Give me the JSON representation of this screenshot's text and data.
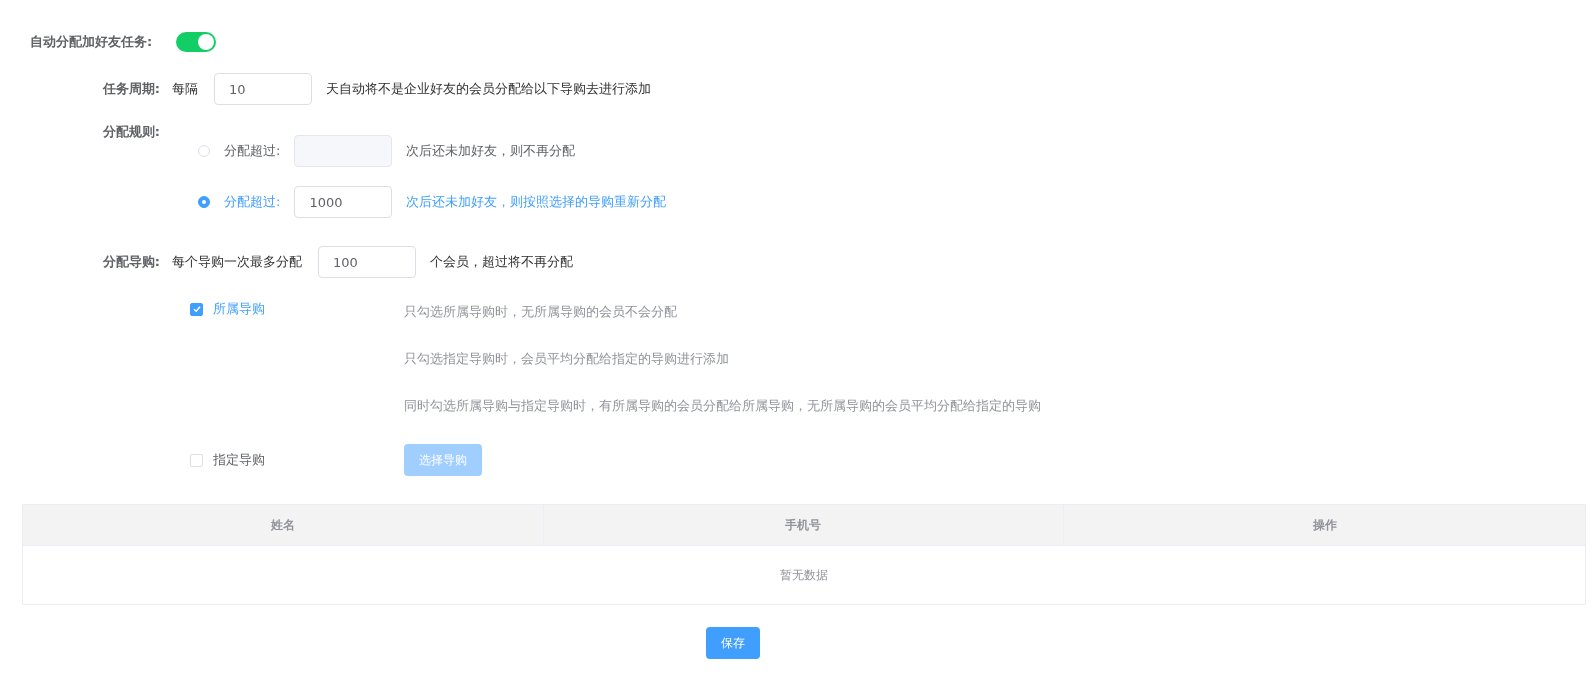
{
  "auto_assign": {
    "label": "自动分配加好友任务:",
    "on": true
  },
  "task_period": {
    "label": "任务周期:",
    "prefix": "每隔",
    "value": "10",
    "suffix": "天自动将不是企业好友的会员分配给以下导购去进行添加"
  },
  "assign_rule": {
    "label": "分配规则:",
    "options": [
      {
        "label": "分配超过:",
        "suffix": "次后还未加好友，则不再分配",
        "selected": false
      },
      {
        "label": "分配超过:",
        "value": "1000",
        "suffix": "次后还未加好友，则按照选择的导购重新分配",
        "selected": true
      }
    ]
  },
  "assign_guide": {
    "label": "分配导购:",
    "prefix": "每个导购一次最多分配",
    "value": "100",
    "suffix": "个会员，超过将不再分配",
    "options": [
      {
        "label": "所属导购",
        "checked": true
      },
      {
        "label": "指定导购",
        "checked": false
      }
    ],
    "hints": [
      "只勾选所属导购时，无所属导购的会员不会分配",
      "只勾选指定导购时，会员平均分配给指定的导购进行添加",
      "同时勾选所属导购与指定导购时，有所属导购的会员分配给所属导购，无所属导购的会员平均分配给指定的导购"
    ],
    "select_button": {
      "label": "选择导购",
      "disabled": true
    }
  },
  "table": {
    "columns": [
      "姓名",
      "手机号",
      "操作"
    ],
    "empty_text": "暂无数据"
  },
  "save_button": "保存"
}
